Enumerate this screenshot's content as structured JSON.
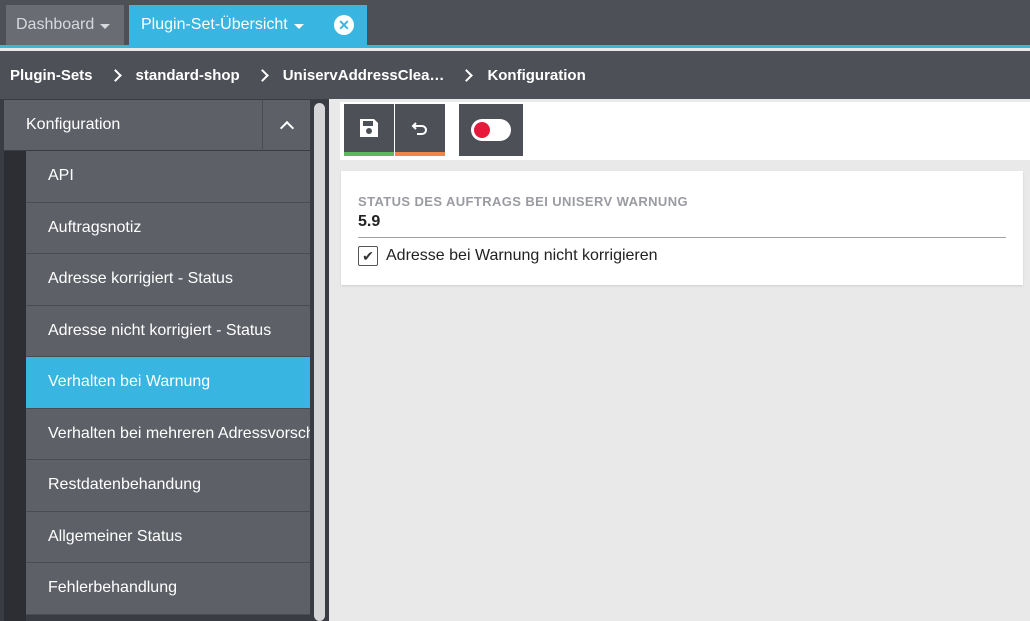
{
  "tabs": [
    {
      "label": "Dashboard",
      "active": false
    },
    {
      "label": "Plugin-Set-Übersicht",
      "active": true
    }
  ],
  "tab_close_icon": "close-circle-icon",
  "breadcrumb": [
    "Plugin-Sets",
    "standard-shop",
    "UniservAddressClea…",
    "Konfiguration"
  ],
  "sidebar": {
    "header": "Konfiguration",
    "items": [
      {
        "label": "API",
        "active": false
      },
      {
        "label": "Auftragsnotiz",
        "active": false
      },
      {
        "label": "Adresse korrigiert - Status",
        "active": false
      },
      {
        "label": "Adresse nicht korrigiert - Status",
        "active": false
      },
      {
        "label": "Verhalten bei Warnung",
        "active": true
      },
      {
        "label": "Verhalten bei mehreren Adressvorschlägen",
        "active": false
      },
      {
        "label": "Restdatenbehandung",
        "active": false
      },
      {
        "label": "Allgemeiner Status",
        "active": false
      },
      {
        "label": "Fehlerbehandlung",
        "active": false
      }
    ]
  },
  "toolbar": {
    "save_icon": "save-icon",
    "undo_icon": "undo-icon",
    "toggle_state": "off"
  },
  "form": {
    "field_label": "STATUS DES AUFTRAGS BEI UNISERV WARNUNG",
    "field_value": "5.9",
    "checkbox_label": "Adresse bei Warnung nicht korrigieren",
    "checkbox_checked": true
  },
  "colors": {
    "accent": "#38b5e0",
    "save_indicator": "#5cb85c",
    "undo_indicator": "#ef8547",
    "toggle_dot": "#e8173b"
  }
}
